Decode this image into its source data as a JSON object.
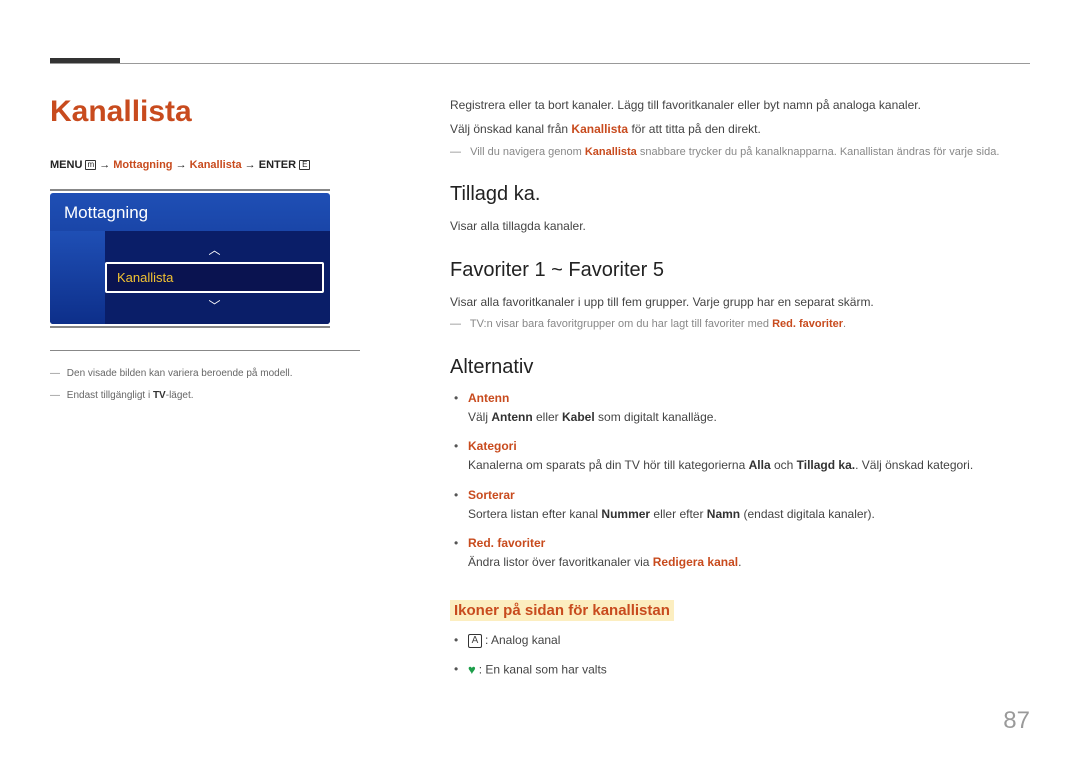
{
  "page_number": "87",
  "left": {
    "title": "Kanallista",
    "breadcrumb": {
      "menu": "MENU",
      "arrow": " → ",
      "seg1": "Mottagning",
      "seg2": "Kanallista",
      "enter": "ENTER"
    },
    "panel": {
      "header": "Mottagning",
      "item": "Kanallista"
    },
    "footnotes": {
      "f1_pre": "Den visade bilden kan variera beroende på modell.",
      "f2_pre": "Endast tillgängligt i ",
      "f2_bold": "TV",
      "f2_post": "-läget."
    }
  },
  "right": {
    "intro1": "Registrera eller ta bort kanaler. Lägg till favoritkanaler eller byt namn på analoga kanaler.",
    "intro2_pre": "Välj önskad kanal från ",
    "intro2_hl": "Kanallista",
    "intro2_post": " för att titta på den direkt.",
    "note1_pre": "Vill du navigera genom ",
    "note1_hl": "Kanallista",
    "note1_post": " snabbare trycker du på kanalknapparna. Kanallistan ändras för varje sida.",
    "h2_1": "Tillagd ka.",
    "p1": "Visar alla tillagda kanaler.",
    "h2_2": "Favoriter 1 ~ Favoriter 5",
    "p2": "Visar alla favoritkanaler i upp till fem grupper. Varje grupp har en separat skärm.",
    "note2_pre": "TV:n visar bara favoritgrupper om du har lagt till favoriter med ",
    "note2_hl": "Red. favoriter",
    "note2_post": ".",
    "h2_3": "Alternativ",
    "options": {
      "o1_term": "Antenn",
      "o1_pre": "Välj ",
      "o1_b1": "Antenn",
      "o1_mid": " eller ",
      "o1_b2": "Kabel",
      "o1_post": " som digitalt kanalläge.",
      "o2_term": "Kategori",
      "o2_pre": "Kanalerna om sparats på din TV hör till kategorierna ",
      "o2_b1": "Alla",
      "o2_mid": " och ",
      "o2_b2": "Tillagd ka.",
      "o2_post": ". Välj önskad kategori.",
      "o3_term": "Sorterar",
      "o3_pre": "Sortera listan efter kanal ",
      "o3_b1": "Nummer",
      "o3_mid": " eller efter ",
      "o3_b2": "Namn",
      "o3_post": " (endast digitala kanaler).",
      "o4_term": "Red. favoriter",
      "o4_pre": "Ändra listor över favoritkanaler via ",
      "o4_b1": "Redigera kanal",
      "o4_post": "."
    },
    "h3": "Ikoner på sidan för kanallistan",
    "icons": {
      "i1_letter": "A",
      "i1_text": ": Analog kanal",
      "i2_text": ": En kanal som har valts"
    }
  }
}
